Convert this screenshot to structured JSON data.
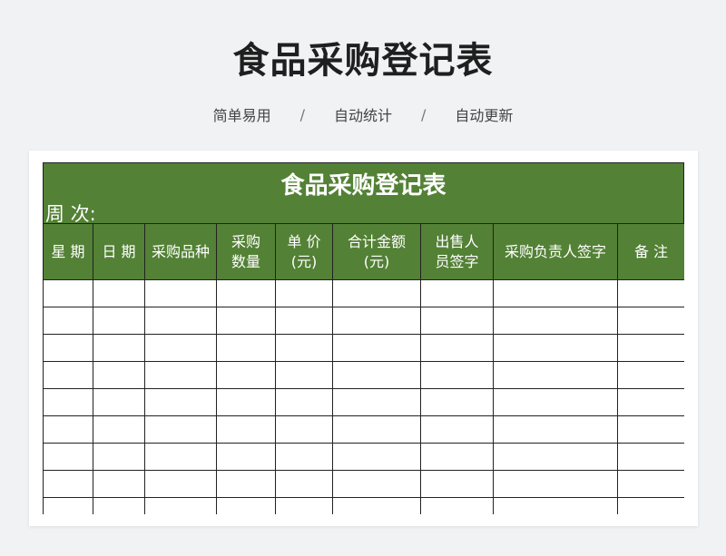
{
  "page": {
    "title": "食品采购登记表",
    "tags": [
      "简单易用",
      "自动统计",
      "自动更新"
    ],
    "separator": "/"
  },
  "sheet": {
    "title": "食品采购登记表",
    "week_label": "周 次:",
    "columns": [
      {
        "line1": "星 期",
        "line2": ""
      },
      {
        "line1": "日 期",
        "line2": ""
      },
      {
        "line1": "采购品种",
        "line2": ""
      },
      {
        "line1": "采购",
        "line2": "数量"
      },
      {
        "line1": "单 价",
        "line2": "(元)"
      },
      {
        "line1": "合计金额",
        "line2": "(元)"
      },
      {
        "line1": "出售人",
        "line2": "员签字"
      },
      {
        "line1": "采购负责人签字",
        "line2": ""
      },
      {
        "line1": "备  注",
        "line2": ""
      }
    ],
    "visible_empty_rows": 9
  },
  "colors": {
    "header_green": "#538135",
    "page_background": "#f1f2f4",
    "title_text": "#1f1f1f"
  }
}
